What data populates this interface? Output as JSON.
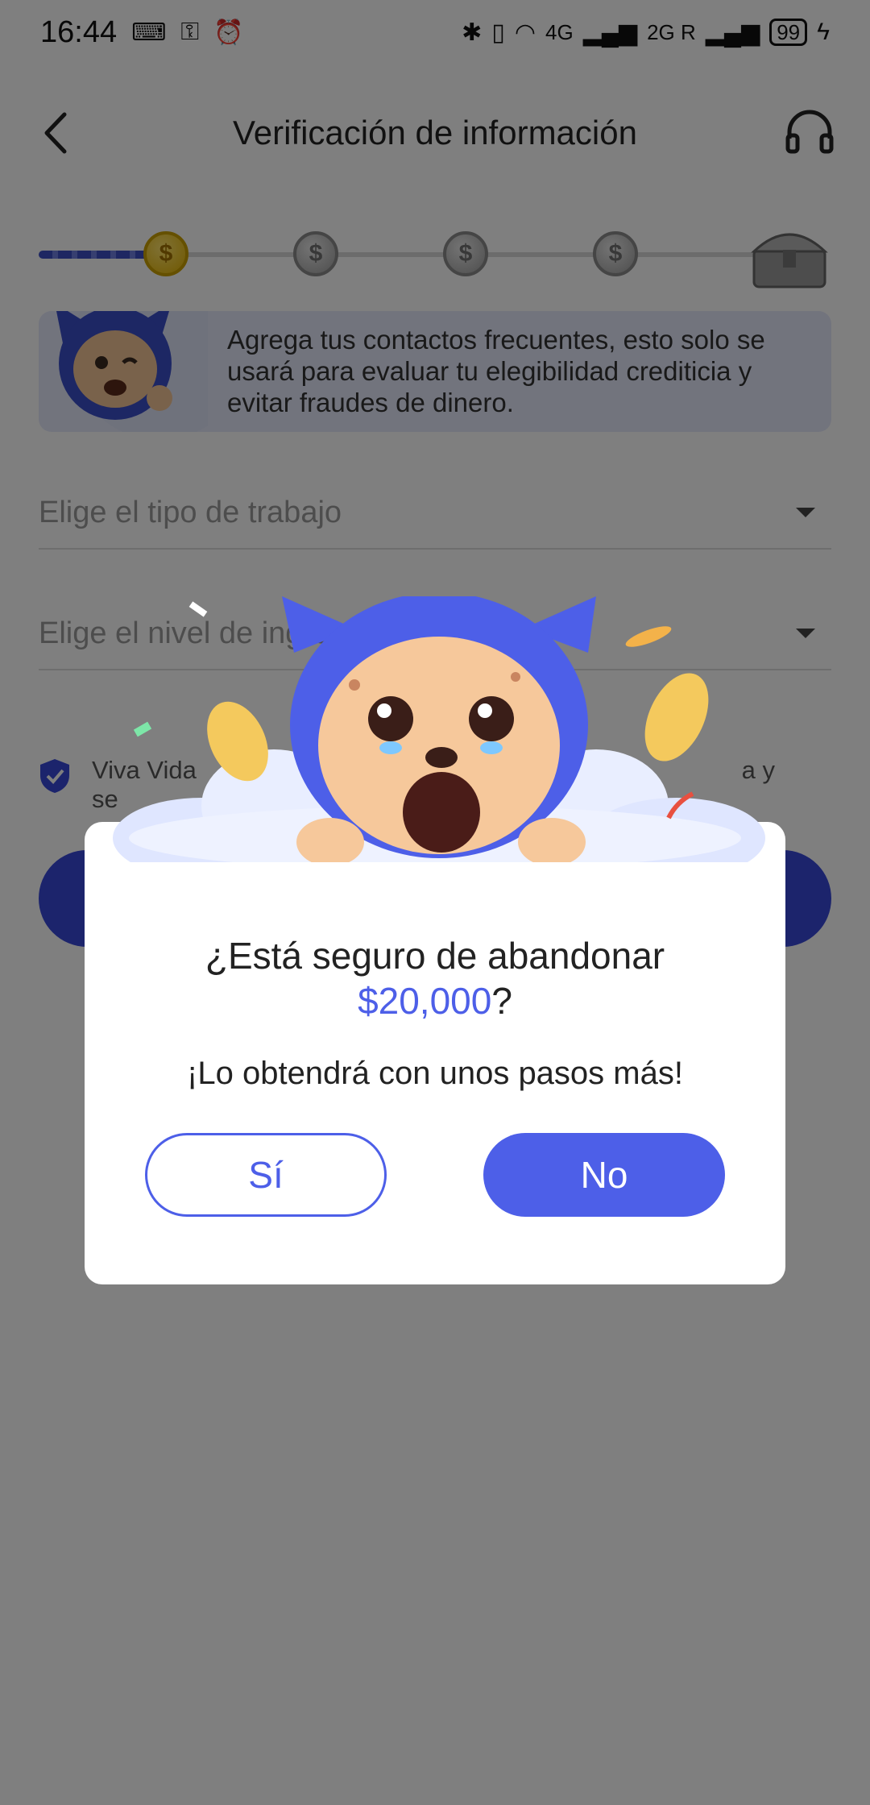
{
  "status_bar": {
    "time": "16:44",
    "network_a": "4G",
    "network_b": "2G R",
    "battery": "99"
  },
  "header": {
    "title": "Verificación de información"
  },
  "progress": {
    "steps_done": 1,
    "steps_total": 5,
    "coin_symbol": "$"
  },
  "banner": {
    "text": "Agrega tus contactos frecuentes, esto solo se usará para evaluar tu elegibilidad crediticia y evitar fraudes de dinero."
  },
  "form": {
    "job_type_placeholder": "Elige el tipo de trabajo",
    "income_level_placeholder": "Elige el nivel de ingreso",
    "consent_start": "Viva Vida",
    "consent_end_line1": "a y",
    "consent_line2": "se"
  },
  "dialog": {
    "question_prefix": "¿Está seguro de abandonar",
    "amount": "$20,000",
    "question_suffix": "?",
    "subtitle": "¡Lo obtendrá con unos pasos más!",
    "yes_label": "Sí",
    "no_label": "No"
  },
  "colors": {
    "accent": "#4d5fe8",
    "primary_dark": "#3848d8",
    "overlay": "rgba(0,0,0,0.5)"
  },
  "icons": [
    "back-arrow-icon",
    "headset-icon",
    "coin-icon",
    "treasure-chest-icon",
    "shield-check-icon",
    "dropdown-caret-icon",
    "mascot-illustration"
  ]
}
